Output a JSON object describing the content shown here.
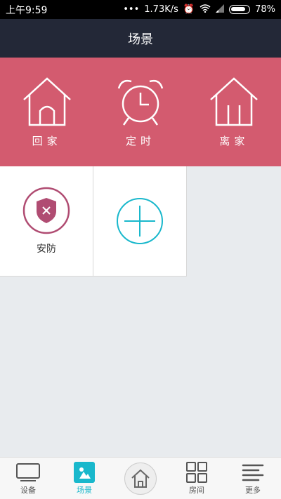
{
  "status_bar": {
    "time": "上午9:59",
    "network_speed": "1.73K/s",
    "battery": "78%"
  },
  "header": {
    "title": "场景"
  },
  "scenes": [
    {
      "label": "回家",
      "icon": "house-door-icon"
    },
    {
      "label": "定时",
      "icon": "alarm-clock-icon"
    },
    {
      "label": "离家",
      "icon": "house-leave-icon"
    }
  ],
  "tiles": [
    {
      "label": "安防",
      "icon": "shield-icon"
    },
    {
      "label": "",
      "icon": "add-icon"
    }
  ],
  "bottom_nav": [
    {
      "label": "设备",
      "icon": "tv-icon"
    },
    {
      "label": "场景",
      "icon": "scene-icon",
      "active": true
    },
    {
      "label": "",
      "icon": "home-icon"
    },
    {
      "label": "房间",
      "icon": "grid-icon"
    },
    {
      "label": "更多",
      "icon": "menu-icon"
    }
  ],
  "colors": {
    "accent": "#19b8cc",
    "hero": "#d35b6f",
    "header": "#232837",
    "shield": "#b04c72"
  }
}
